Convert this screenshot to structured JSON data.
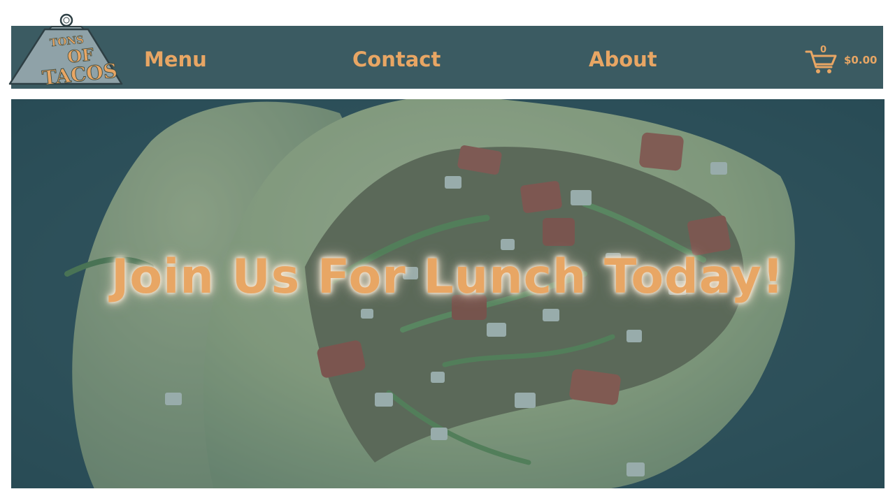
{
  "brand": {
    "logo_line1": "TONS",
    "logo_line2": "OF",
    "logo_line3": "TACOS"
  },
  "nav": {
    "items": [
      {
        "label": "Menu"
      },
      {
        "label": "Contact"
      },
      {
        "label": "About"
      }
    ]
  },
  "cart": {
    "count": "0",
    "total": "$0.00"
  },
  "hero": {
    "heading": "Join Us For Lunch Today!"
  },
  "colors": {
    "navbar_bg": "#3b5b62",
    "accent": "#e8a664",
    "logo_weight": "#8fa2a8"
  }
}
